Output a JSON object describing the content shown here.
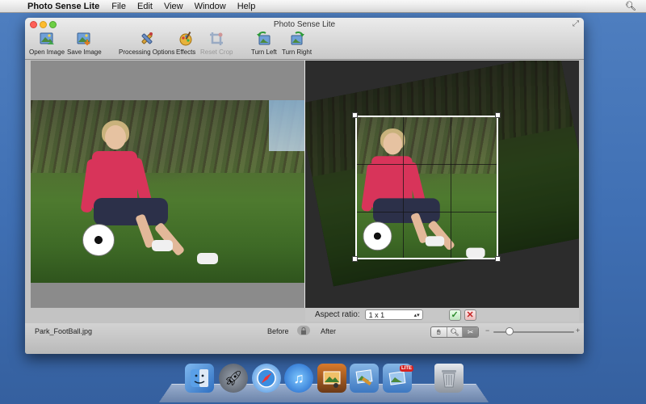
{
  "menubar": {
    "app_name": "Photo Sense Lite",
    "items": [
      "File",
      "Edit",
      "View",
      "Window",
      "Help"
    ]
  },
  "window": {
    "title": "Photo Sense Lite"
  },
  "toolbar": {
    "open_image": "Open Image",
    "save_image": "Save Image",
    "processing_options": "Processing Options",
    "effects": "Effects",
    "reset_crop": "Reset Crop",
    "turn_left": "Turn Left",
    "turn_right": "Turn Right"
  },
  "crop": {
    "aspect_label": "Aspect ratio:",
    "aspect_value": "1 x 1"
  },
  "status": {
    "filename": "Park_FootBall.jpg",
    "before": "Before",
    "after": "After",
    "zoom_level": 0.2
  },
  "dock": {
    "lite_badge": "LITE"
  },
  "colors": {
    "desktop": "#4a7abd",
    "crop_border": "#ffffff",
    "confirm": "#2a8a2a",
    "cancel": "#c42222"
  }
}
